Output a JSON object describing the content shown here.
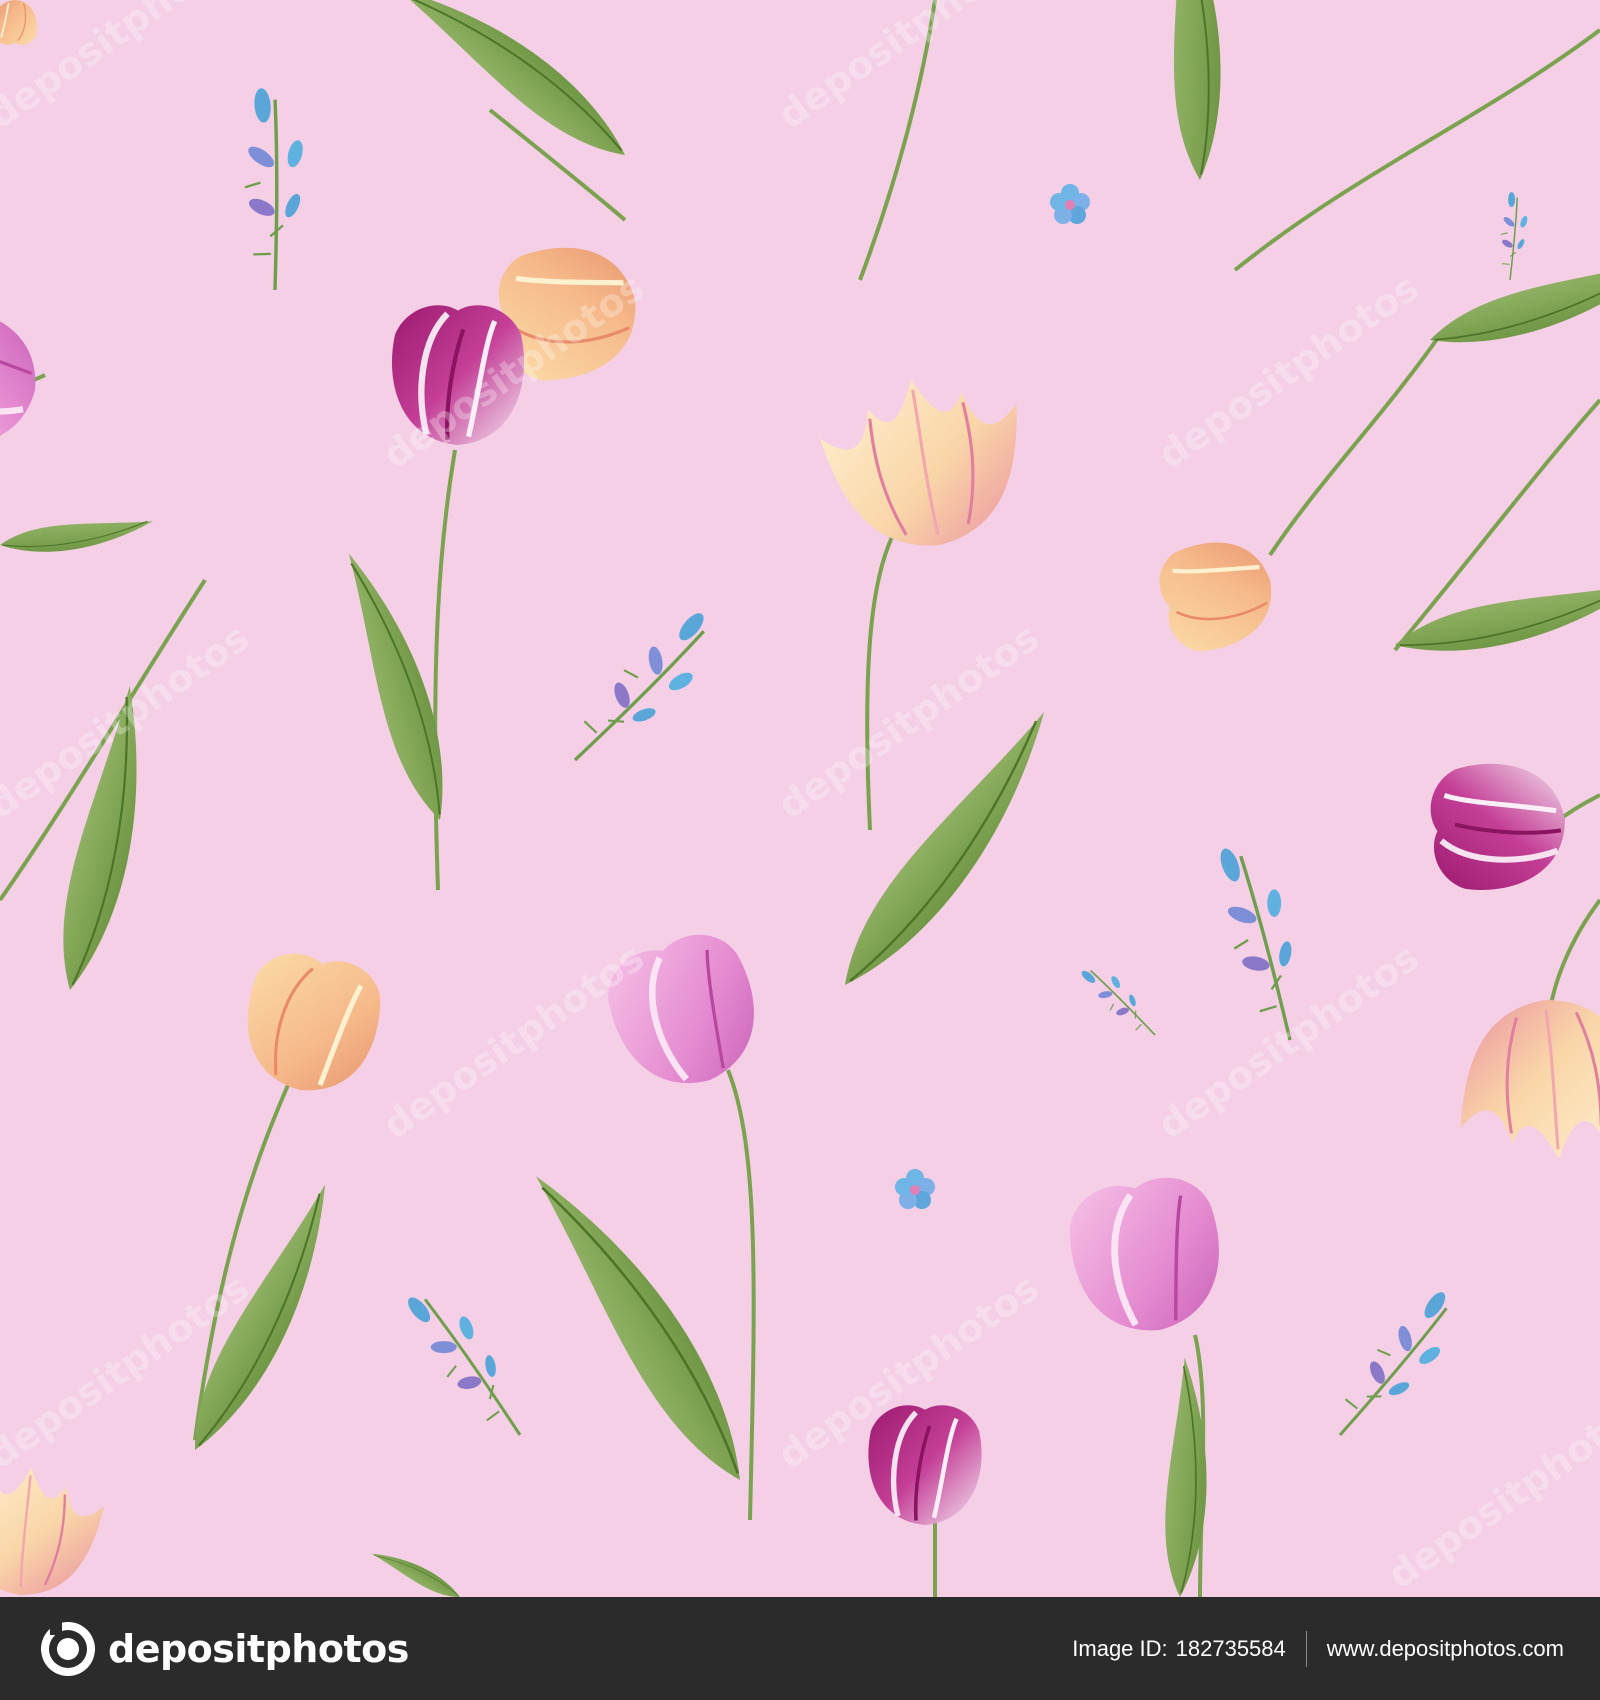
{
  "image": {
    "subject": "seamless tulip pattern",
    "background_color": "#f4cfe6",
    "footer_color": "#2b2b2b",
    "watermark_text": "depositphotos"
  },
  "footer": {
    "brand_name": "depositphotos",
    "image_id_label": "Image ID:",
    "image_id": "182735584",
    "site_url": "www.depositphotos.com"
  },
  "icons": {
    "brand_logo": "depositphotos-logo-icon"
  }
}
